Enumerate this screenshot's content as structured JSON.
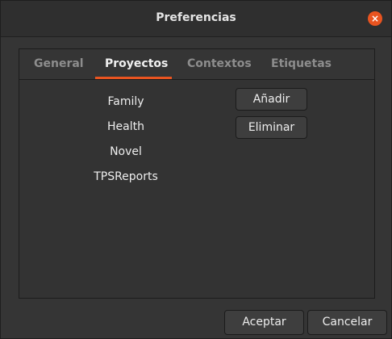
{
  "window": {
    "title": "Preferencias",
    "close_icon": "×",
    "accent_color": "#e95420"
  },
  "tabs": [
    {
      "label": "General",
      "active": false
    },
    {
      "label": "Proyectos",
      "active": true
    },
    {
      "label": "Contextos",
      "active": false
    },
    {
      "label": "Etiquetas",
      "active": false
    }
  ],
  "projects": {
    "items": [
      "Family",
      "Health",
      "Novel",
      "TPSReports"
    ],
    "add_label": "Añadir",
    "remove_label": "Eliminar"
  },
  "footer": {
    "accept_label": "Aceptar",
    "cancel_label": "Cancelar"
  }
}
